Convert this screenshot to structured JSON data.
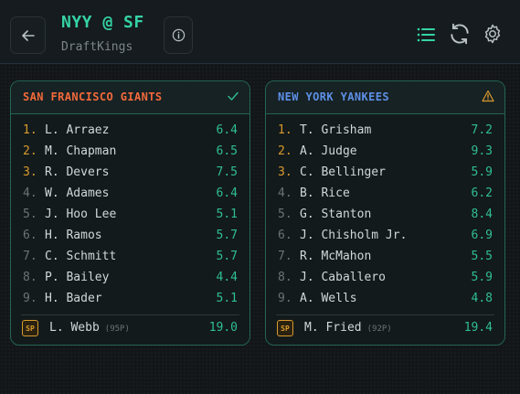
{
  "header": {
    "title": "NYY @ SF",
    "subtitle": "DraftKings"
  },
  "colors": {
    "accent": "#35d3a6",
    "value": "#2fbf92",
    "order_top": "#d99a2e",
    "order_rest": "#6b7377",
    "sf": "#f2693a",
    "nyy": "#5d8fe6",
    "warning": "#d99a2e"
  },
  "teams": [
    {
      "name": "SAN FRANCISCO GIANTS",
      "status_icon": "check-icon",
      "lineup": [
        {
          "order": "1.",
          "player": "L. Arraez",
          "value": "6.4"
        },
        {
          "order": "2.",
          "player": "M. Chapman",
          "value": "6.5"
        },
        {
          "order": "3.",
          "player": "R. Devers",
          "value": "7.5"
        },
        {
          "order": "4.",
          "player": "W. Adames",
          "value": "6.4"
        },
        {
          "order": "5.",
          "player": "J. Hoo Lee",
          "value": "5.1"
        },
        {
          "order": "6.",
          "player": "H. Ramos",
          "value": "5.7"
        },
        {
          "order": "7.",
          "player": "C. Schmitt",
          "value": "5.7"
        },
        {
          "order": "8.",
          "player": "P. Bailey",
          "value": "4.4"
        },
        {
          "order": "9.",
          "player": "H. Bader",
          "value": "5.1"
        }
      ],
      "pitcher": {
        "badge": "SP",
        "name": "L. Webb",
        "pitches": "(95P)",
        "value": "19.0"
      }
    },
    {
      "name": "NEW YORK YANKEES",
      "status_icon": "warning-icon",
      "lineup": [
        {
          "order": "1.",
          "player": "T. Grisham",
          "value": "7.2"
        },
        {
          "order": "2.",
          "player": "A. Judge",
          "value": "9.3"
        },
        {
          "order": "3.",
          "player": "C. Bellinger",
          "value": "5.9"
        },
        {
          "order": "4.",
          "player": "B. Rice",
          "value": "6.2"
        },
        {
          "order": "5.",
          "player": "G. Stanton",
          "value": "8.4"
        },
        {
          "order": "6.",
          "player": "J. Chisholm Jr.",
          "value": "6.9"
        },
        {
          "order": "7.",
          "player": "R. McMahon",
          "value": "5.5"
        },
        {
          "order": "8.",
          "player": "J. Caballero",
          "value": "5.9"
        },
        {
          "order": "9.",
          "player": "A. Wells",
          "value": "4.8"
        }
      ],
      "pitcher": {
        "badge": "SP",
        "name": "M. Fried",
        "pitches": "(92P)",
        "value": "19.4"
      }
    }
  ]
}
